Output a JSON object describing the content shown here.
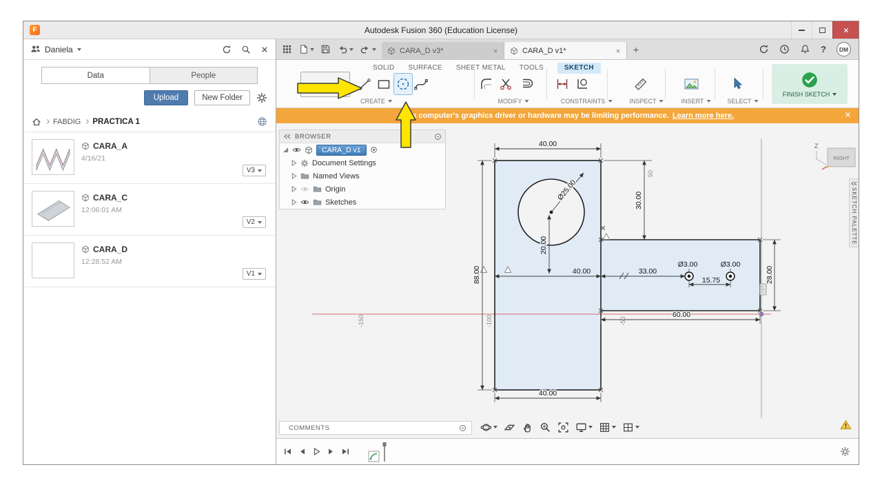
{
  "window": {
    "title": "Autodesk Fusion 360 (Education License)",
    "logo_letter": "F"
  },
  "data_panel": {
    "user_name": "Daniela",
    "tab_data": "Data",
    "tab_people": "People",
    "upload_button": "Upload",
    "new_folder_button": "New Folder",
    "breadcrumb": {
      "folder": "FABDIG",
      "current": "PRACTICA 1"
    },
    "items": [
      {
        "name": "CARA_A",
        "modified": "4/16/21",
        "version": "V3"
      },
      {
        "name": "CARA_C",
        "modified": "12:06:01 AM",
        "version": "V2"
      },
      {
        "name": "CARA_D",
        "modified": "12:28:52 AM",
        "version": "V1"
      }
    ]
  },
  "doc_tabs": {
    "tab1": "CARA_D v3*",
    "tab2": "CARA_D v1*",
    "new_tab": "+"
  },
  "account": {
    "avatar": "DM",
    "help_glyph": "?"
  },
  "ribbon": {
    "env_tabs": [
      "SOLID",
      "SURFACE",
      "SHEET METAL",
      "TOOLS",
      "SKETCH"
    ],
    "groups": {
      "create": "CREATE",
      "modify": "MODIFY",
      "constraints": "CONSTRAINTS",
      "inspect": "INSPECT",
      "insert": "INSERT",
      "select": "SELECT",
      "finish_sketch": "FINISH SKETCH"
    }
  },
  "banner": {
    "message": "This computer's graphics driver or hardware may be limiting performance.",
    "link": "Learn more here."
  },
  "browser": {
    "title": "BROWSER",
    "root_item": "CARA_D v1",
    "items": [
      "Document Settings",
      "Named Views",
      "Origin",
      "Sketches"
    ]
  },
  "canvas": {
    "comments_label": "COMMENTS",
    "viewcube_face": "RIGHT",
    "viewcube_axis": "Z",
    "palette_label": "SKETCH PALETTE",
    "dimensions": {
      "top_width": "40.00",
      "overall_height": "88.00",
      "upper_right_height": "30.00",
      "circle_diameter": "Ø25.00",
      "circle_center_drop": "20.00",
      "mid_width": "40.00",
      "edge_to_hole": "33.00",
      "hole_spacing": "15.75",
      "hole_left_dia": "Ø3.00",
      "hole_right_dia": "Ø3.00",
      "arm_height": "28.00",
      "arm_length": "60.00",
      "bottom_width": "40.00"
    },
    "grid_labels": {
      "xm150": "-150",
      "xm100": "-100",
      "xm50": "-50",
      "y50": "50"
    }
  }
}
